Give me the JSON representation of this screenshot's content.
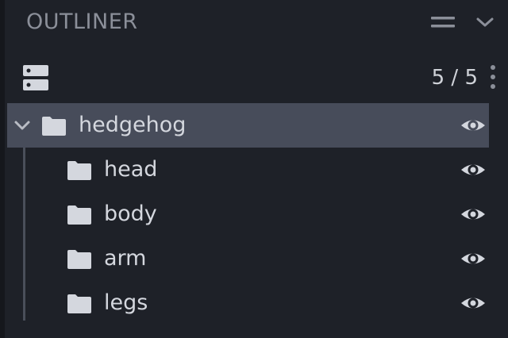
{
  "panel": {
    "title": "OUTLINER",
    "count": "5 / 5"
  },
  "icons": {
    "header_menu": "hamburger-icon",
    "header_collapse": "chevron-down-icon",
    "add_group": "add-group-icon",
    "more": "kebab-icon",
    "expand": "chevron-down-icon",
    "folder": "folder-icon",
    "visibility": "eye-icon"
  },
  "tree": {
    "root": {
      "label": "hedgehog",
      "expanded": true,
      "selected": true,
      "visible": true
    },
    "children": [
      {
        "label": "head",
        "visible": true
      },
      {
        "label": "body",
        "visible": true
      },
      {
        "label": "arm",
        "visible": true
      },
      {
        "label": "legs",
        "visible": true
      }
    ]
  },
  "colors": {
    "background": "#1e2128",
    "selected_row": "#474c5a",
    "text": "#d4d7de",
    "title": "#8b8f99",
    "icon": "#d4d7de"
  }
}
